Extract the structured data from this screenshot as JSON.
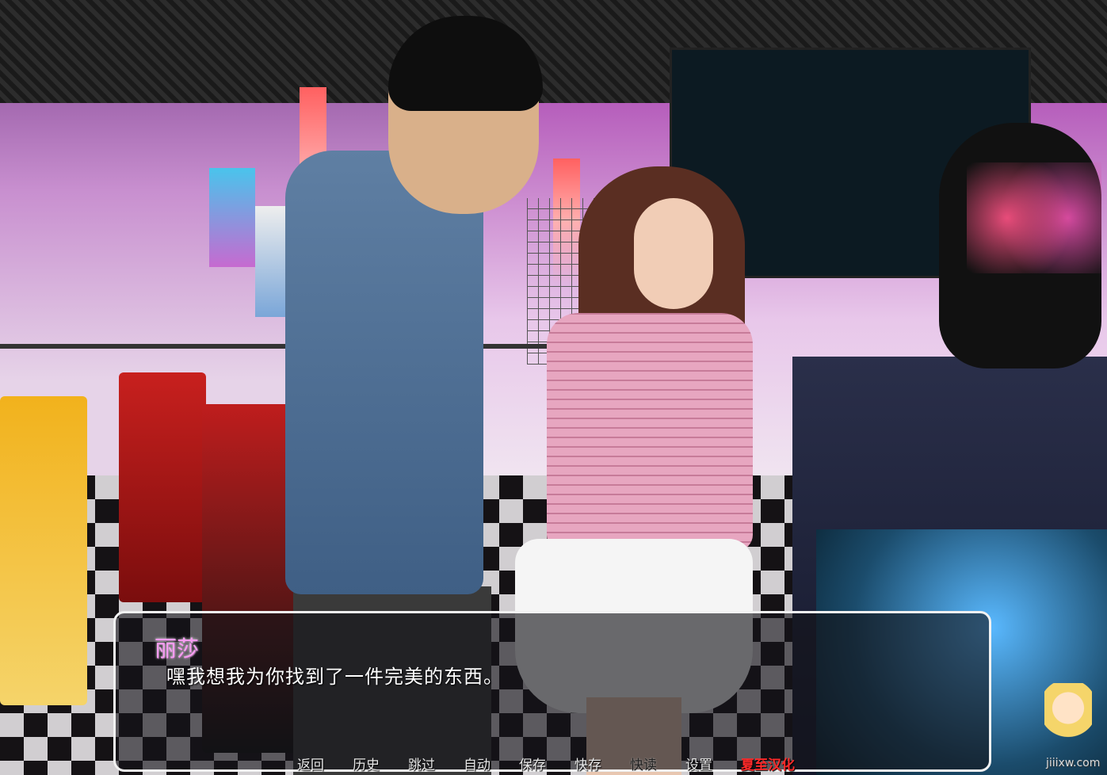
{
  "dialogue": {
    "speaker": "丽莎",
    "text": "嘿我想我为你找到了一件完美的东西。",
    "speaker_color": "#f79cf3"
  },
  "quick_menu": {
    "items": [
      "返回",
      "历史",
      "跳过",
      "自动",
      "保存",
      "快存",
      "快读",
      "设置"
    ],
    "credit": "夏至汉化"
  },
  "watermark": "jiiixw.com"
}
